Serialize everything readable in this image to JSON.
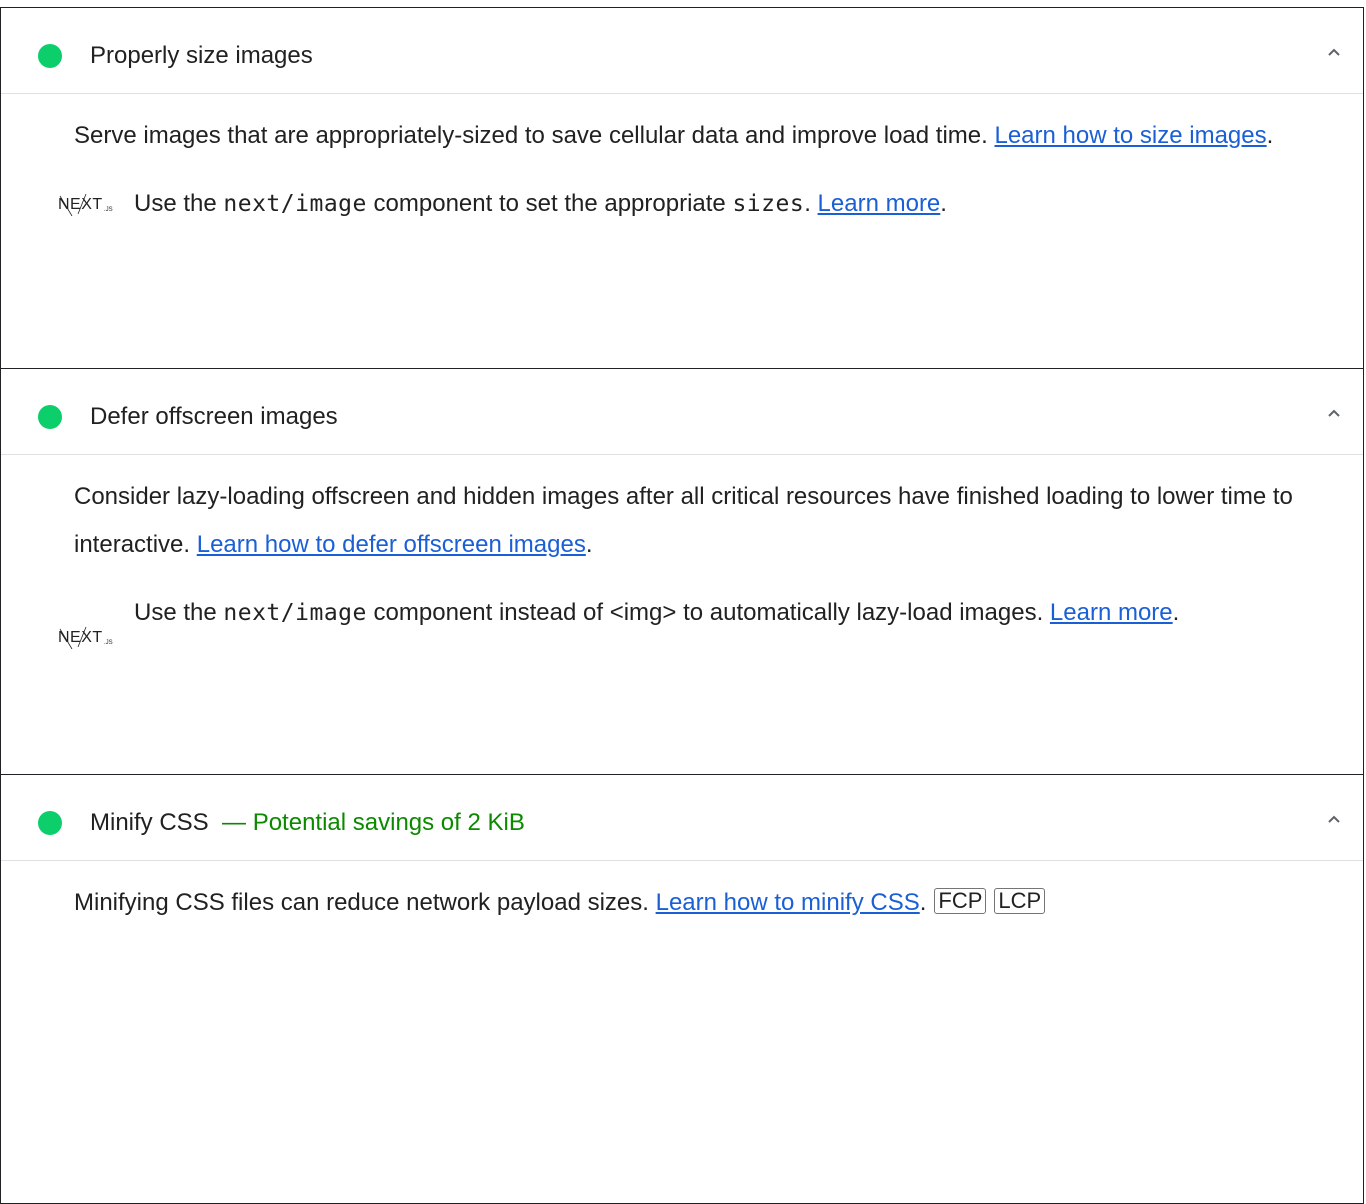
{
  "audits": [
    {
      "title": "Properly size images",
      "description_text": "Serve images that are appropriately-sized to save cellular data and improve load time. ",
      "description_link": "Learn how to size images",
      "stack": {
        "icon": "nextjs-logo-icon",
        "text_before": "Use the ",
        "code1": "next/image",
        "text_middle": " component to set the appropriate ",
        "code2": "sizes",
        "text_after": ". ",
        "link": "Learn more"
      }
    },
    {
      "title": "Defer offscreen images",
      "description_text": "Consider lazy-loading offscreen and hidden images after all critical resources have finished loading to lower time to interactive. ",
      "description_link": "Learn how to defer offscreen images",
      "stack": {
        "icon": "nextjs-logo-icon",
        "text_before": "Use the ",
        "code1": "next/image",
        "text_middle": " component instead of ",
        "code2": "<img>",
        "text_after": " to automatically lazy-load images. ",
        "link": "Learn more"
      }
    },
    {
      "title": "Minify CSS",
      "savings": "— Potential savings of 2 KiB",
      "description_text": "Minifying CSS files can reduce network payload sizes. ",
      "description_link": "Learn how to minify CSS",
      "tags": [
        "FCP",
        "LCP"
      ]
    }
  ],
  "colors": {
    "pass": "#0cce6b",
    "savings": "#0b8a00",
    "link": "#1a5fd6"
  },
  "period": "."
}
